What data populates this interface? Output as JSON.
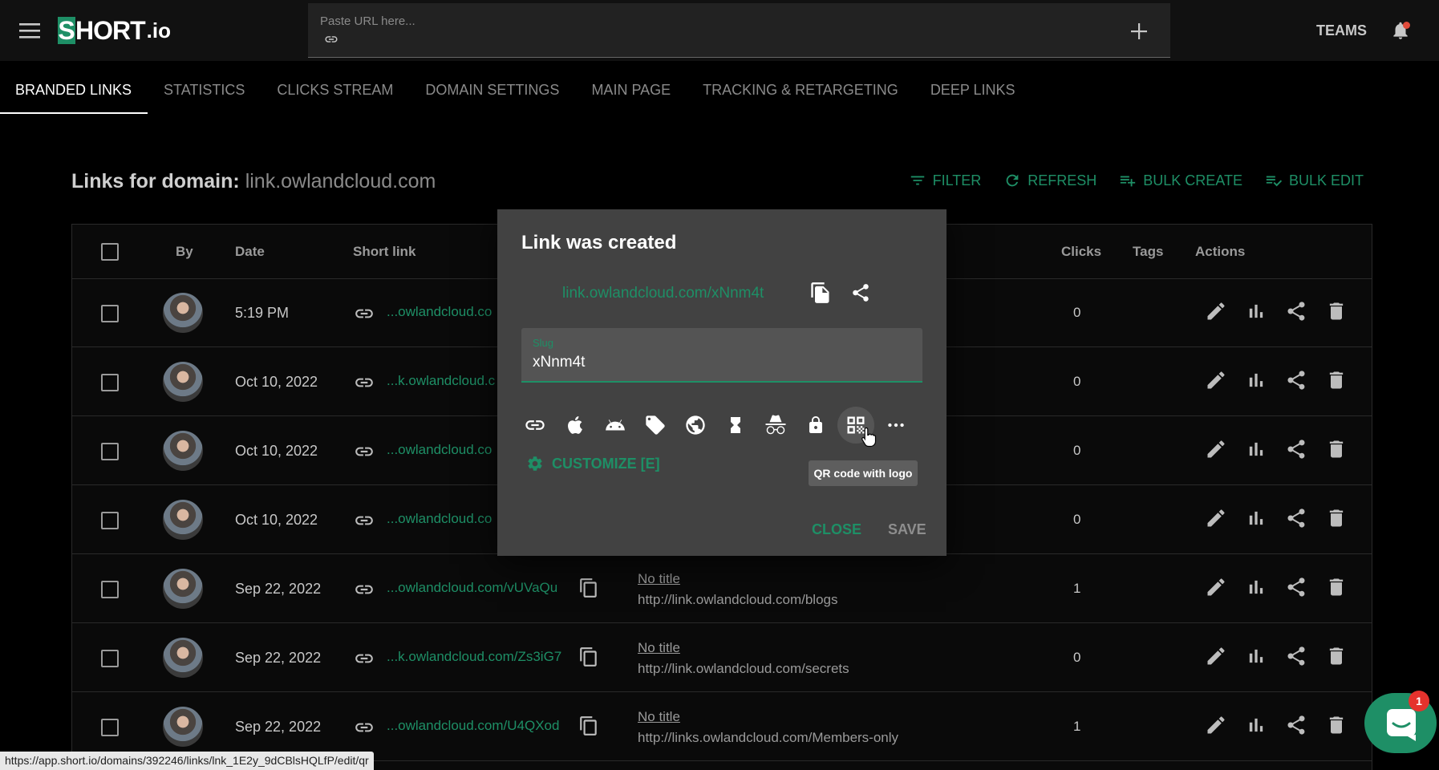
{
  "header": {
    "logo_s": "S",
    "logo_rest": "HORT",
    "logo_tld": ".io",
    "url_placeholder": "Paste URL here...",
    "teams_label": "TEAMS"
  },
  "tabs": [
    {
      "label": "BRANDED LINKS",
      "active": true
    },
    {
      "label": "STATISTICS"
    },
    {
      "label": "CLICKS STREAM"
    },
    {
      "label": "DOMAIN SETTINGS"
    },
    {
      "label": "MAIN PAGE"
    },
    {
      "label": "TRACKING & RETARGETING"
    },
    {
      "label": "DEEP LINKS"
    }
  ],
  "page": {
    "title_prefix": "Links for domain: ",
    "domain": "link.owlandcloud.com",
    "tools": {
      "filter": "FILTER",
      "refresh": "REFRESH",
      "bulk_create": "BULK CREATE",
      "bulk_edit": "BULK EDIT"
    }
  },
  "table": {
    "columns": {
      "by": "By",
      "date": "Date",
      "short_link": "Short link",
      "clicks": "Clicks",
      "tags": "Tags",
      "actions": "Actions"
    },
    "rows": [
      {
        "date": "5:19 PM",
        "short": "...owlandcloud.co",
        "title": "",
        "dest": "",
        "clicks": "0"
      },
      {
        "date": "Oct 10, 2022",
        "short": "...k.owlandcloud.c",
        "title": "",
        "dest": "",
        "clicks": "0"
      },
      {
        "date": "Oct 10, 2022",
        "short": "...owlandcloud.co",
        "title": "",
        "dest": "",
        "clicks": "0"
      },
      {
        "date": "Oct 10, 2022",
        "short": "...owlandcloud.co",
        "title": "",
        "dest": "",
        "clicks": "0"
      },
      {
        "date": "Sep 22, 2022",
        "short": "...owlandcloud.com/vUVaQu",
        "title": "No title",
        "dest": "http://link.owlandcloud.com/blogs",
        "clicks": "1"
      },
      {
        "date": "Sep 22, 2022",
        "short": "...k.owlandcloud.com/Zs3iG7",
        "title": "No title",
        "dest": "http://link.owlandcloud.com/secrets",
        "clicks": "0"
      },
      {
        "date": "Sep 22, 2022",
        "short": "...owlandcloud.com/U4QXod",
        "title": "No title",
        "dest": "http://links.owlandcloud.com/Members-only",
        "clicks": "1"
      }
    ]
  },
  "dialog": {
    "title": "Link was created",
    "link": "link.owlandcloud.com/xNnm4t",
    "slug_label": "Slug",
    "slug_value": "xNnm4t",
    "customize_label": "CUSTOMIZE [E]",
    "tooltip": "QR code with logo",
    "close_label": "CLOSE",
    "save_label": "SAVE",
    "options": [
      "link-icon",
      "apple-icon",
      "android-icon",
      "tag-icon",
      "globe-icon",
      "hourglass-icon",
      "spy-icon",
      "lock-icon",
      "qr-code-icon",
      "more-icon"
    ]
  },
  "statusbar": {
    "url": "https://app.short.io/domains/392246/links/lnk_1E2y_9dCBlsHQLfP/edit/qr"
  },
  "chat": {
    "badge": "1"
  },
  "colors": {
    "accent": "#1e8f66",
    "dialog_bg": "#424242",
    "page_bg": "#000000"
  }
}
